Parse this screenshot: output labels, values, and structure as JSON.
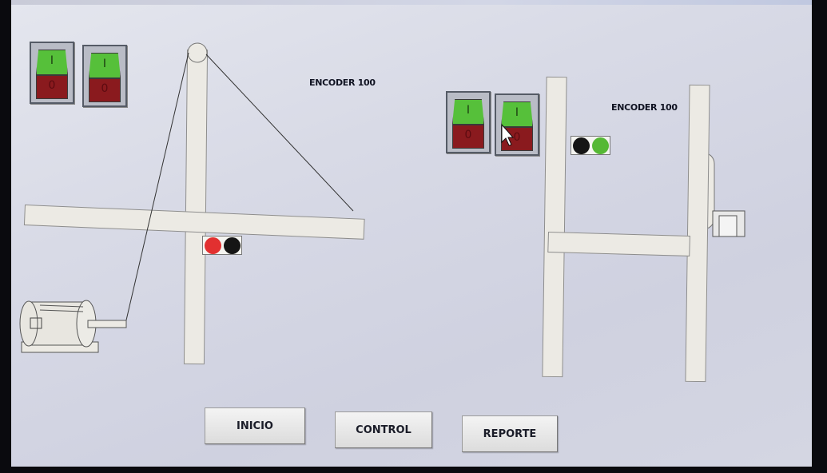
{
  "left_panel": {
    "switches": [
      {
        "on_label": "I",
        "off_label": "0"
      },
      {
        "on_label": "I",
        "off_label": "0"
      }
    ],
    "encoder_label": "ENCODER 100",
    "indicator_lights": [
      "#e23030",
      "#151515"
    ]
  },
  "right_panel": {
    "switches": [
      {
        "on_label": "I",
        "off_label": "0"
      },
      {
        "on_label": "I",
        "off_label": "0"
      }
    ],
    "encoder_label": "ENCODER 100",
    "indicator_lights": [
      "#151515",
      "#55b835"
    ]
  },
  "nav_buttons": {
    "inicio": "INICIO",
    "control": "CONTROL",
    "reporte": "REPORTE"
  },
  "colors": {
    "switch_on": "#56c03a",
    "switch_off": "#8a1a1e",
    "light_red": "#e23030",
    "light_green": "#55b835"
  }
}
